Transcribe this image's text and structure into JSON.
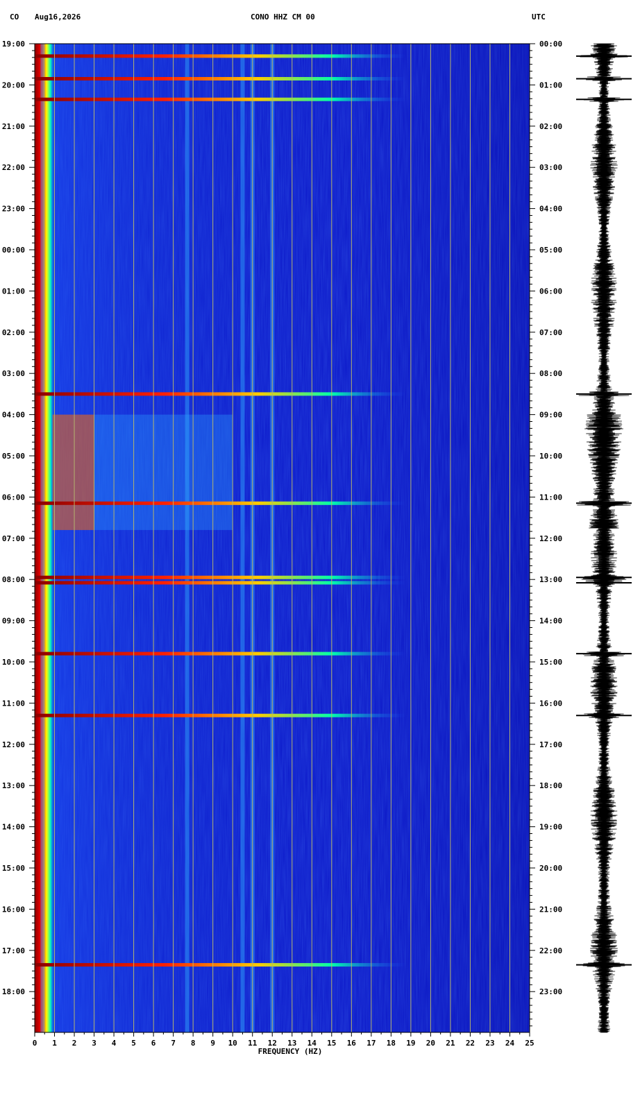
{
  "header": {
    "network": "CO",
    "date": "Aug16,2026",
    "station": "CONO HHZ CM 00",
    "utc_label": "UTC"
  },
  "chart_data": {
    "type": "heatmap",
    "title": "CONO HHZ CM 00",
    "xlabel": "FREQUENCY (HZ)",
    "xlim": [
      0,
      25
    ],
    "x_ticks": [
      "0",
      "1",
      "2",
      "3",
      "4",
      "5",
      "6",
      "7",
      "8",
      "9",
      "10",
      "11",
      "12",
      "13",
      "14",
      "15",
      "16",
      "17",
      "18",
      "19",
      "20",
      "21",
      "22",
      "23",
      "24",
      "25"
    ],
    "left_time_labels": [
      "19:00",
      "20:00",
      "21:00",
      "22:00",
      "23:00",
      "00:00",
      "01:00",
      "02:00",
      "03:00",
      "04:00",
      "05:00",
      "06:00",
      "07:00",
      "08:00",
      "09:00",
      "10:00",
      "11:00",
      "12:00",
      "13:00",
      "14:00",
      "15:00",
      "16:00",
      "17:00",
      "18:00"
    ],
    "right_time_labels": [
      "00:00",
      "01:00",
      "02:00",
      "03:00",
      "04:00",
      "05:00",
      "06:00",
      "07:00",
      "08:00",
      "09:00",
      "10:00",
      "11:00",
      "12:00",
      "13:00",
      "14:00",
      "15:00",
      "16:00",
      "17:00",
      "18:00",
      "19:00",
      "20:00",
      "21:00",
      "22:00",
      "23:00"
    ],
    "colormap": [
      "#00008b",
      "#0000ff",
      "#00bfff",
      "#00ff80",
      "#ffff00",
      "#ff8000",
      "#ff0000",
      "#8b0000"
    ],
    "background_color": "#0a14c8",
    "gridline_color": "#b4b46e",
    "strong_bands_hours": [
      0.3,
      0.85,
      1.35,
      8.5,
      11.15,
      12.95,
      13.08,
      14.8,
      16.3,
      22.35
    ],
    "bright_zone_hours": [
      [
        9.0,
        11.8
      ]
    ],
    "persistent_frequency_lines_hz": [
      0.4,
      7.7,
      10.5,
      11.0,
      12.0
    ],
    "seismogram_color": "#000000"
  }
}
